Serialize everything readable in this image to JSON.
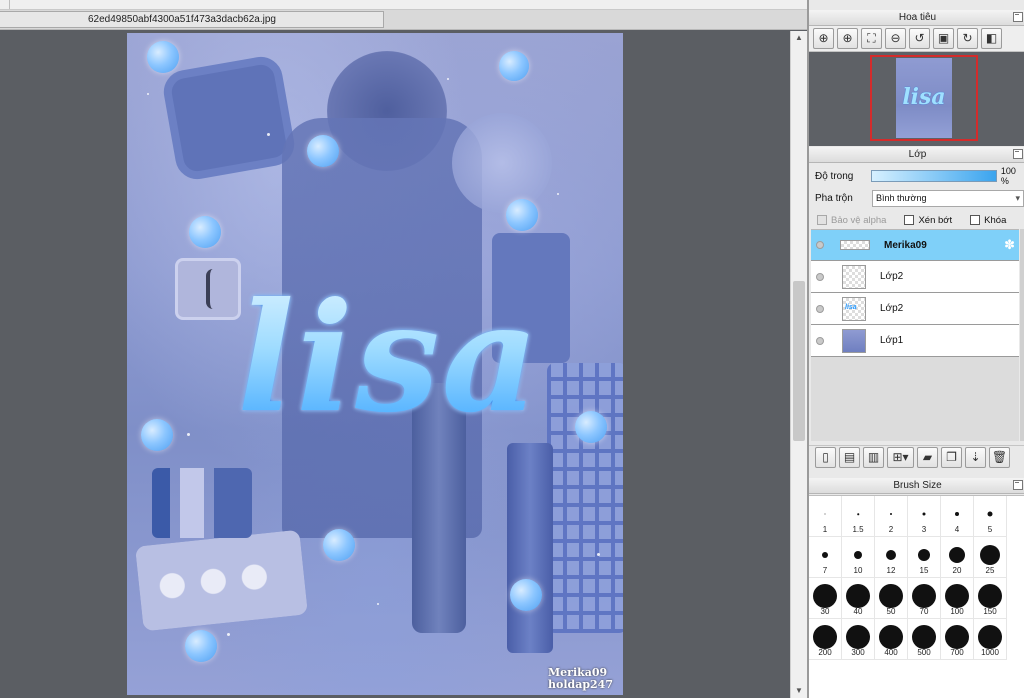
{
  "document": {
    "filename": "62ed49850abf4300a51f473a3dacb62a.jpg"
  },
  "artwork": {
    "title_text": "lisa",
    "watermark_line1": "Merika09",
    "watermark_line2": "holdap247"
  },
  "navigator": {
    "title": "Hoa tiêu",
    "tools": [
      "zoom-actual-icon",
      "zoom-in-icon",
      "fit-icon",
      "zoom-out-icon",
      "rotate-left-icon",
      "fit-window-icon",
      "rotate-right-icon",
      "flip-icon"
    ]
  },
  "layers_panel": {
    "title": "Lớp",
    "opacity_label": "Độ trong",
    "opacity_value": "100 %",
    "opacity_fraction": 1.0,
    "blend_label": "Pha trộn",
    "blend_value": "Bình thường",
    "protect_alpha_label": "Bảo vệ alpha",
    "clipping_label": "Xén bớt",
    "lock_label": "Khóa",
    "layers": [
      {
        "name": "Merika09",
        "selected": true,
        "thumb": "wide"
      },
      {
        "name": "Lớp2",
        "selected": false,
        "thumb": "empty"
      },
      {
        "name": "Lớp2",
        "selected": false,
        "thumb": "text"
      },
      {
        "name": "Lớp1",
        "selected": false,
        "thumb": "photo"
      }
    ]
  },
  "brush_panel": {
    "title": "Brush Size",
    "sizes": [
      "1",
      "1.5",
      "2",
      "3",
      "4",
      "5",
      "7",
      "10",
      "12",
      "15",
      "20",
      "25",
      "30",
      "40",
      "50",
      "70",
      "100",
      "150",
      "200",
      "300",
      "400",
      "500",
      "700",
      "1000"
    ]
  }
}
